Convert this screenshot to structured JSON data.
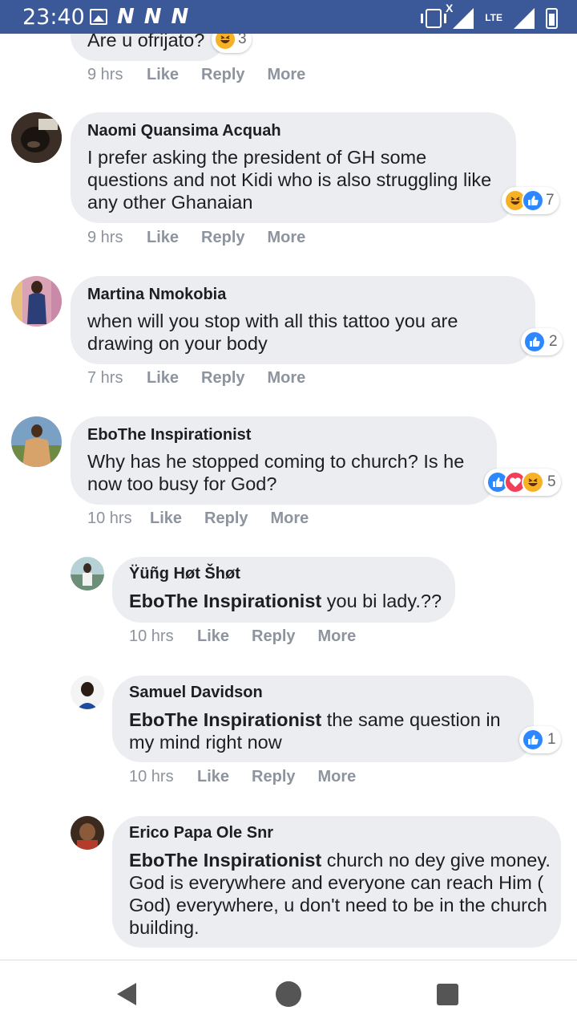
{
  "status_bar": {
    "time": "23:40",
    "notification_icons": [
      "image-icon",
      "n-icon",
      "n-icon",
      "n-icon"
    ],
    "n_glyph": "N",
    "network": "LTE",
    "signal_x": "X"
  },
  "comments": [
    {
      "text": "Are u ofrijato?",
      "time": "9 hrs",
      "reaction_icons": [
        "haha"
      ],
      "reaction_count": "3"
    },
    {
      "author": "Naomi Quansima Acquah",
      "text": "I prefer asking the president of GH some questions and not Kidi who is also struggling like any other Ghanaian",
      "time": "9 hrs",
      "reaction_icons": [
        "haha",
        "like"
      ],
      "reaction_count": "7"
    },
    {
      "author": "Martina Nmokobia",
      "text": "when will you stop with all this tattoo you are drawing on your body",
      "time": "7 hrs",
      "reaction_icons": [
        "like"
      ],
      "reaction_count": "2"
    },
    {
      "author": "EboThe Inspirationist",
      "text": "Why has he stopped coming to church? Is he now too busy for God?",
      "time": "10 hrs",
      "reaction_icons": [
        "like",
        "love",
        "haha"
      ],
      "reaction_count": "5"
    },
    {
      "author": "Ÿüñg Høt Šhøt",
      "mention": "EboThe Inspirationist",
      "text": " you bi lady.??",
      "time": "10 hrs",
      "reply": true
    },
    {
      "author": "Samuel Davidson",
      "mention": "EboThe Inspirationist",
      "text": " the same question in my mind right now",
      "time": "10 hrs",
      "reply": true,
      "reaction_icons": [
        "like"
      ],
      "reaction_count": "1"
    },
    {
      "author": "Erico Papa Ole Snr",
      "mention": "EboThe Inspirationist",
      "text": " church no dey give money. God is everywhere and everyone can reach Him ( God) everywhere, u don't need to be in the church building.",
      "reply": true
    }
  ],
  "actions": {
    "like": "Like",
    "reply": "Reply",
    "more": "More"
  },
  "colors": {
    "status_bar": "#3b5998",
    "bubble": "#ebedf0",
    "meta_text": "#8d949e",
    "like": "#2d88ff",
    "love": "#f33e58",
    "haha": "#f7b125"
  },
  "nav_bar": {
    "icons": [
      "back-icon",
      "home-icon",
      "recent-apps-icon"
    ]
  }
}
